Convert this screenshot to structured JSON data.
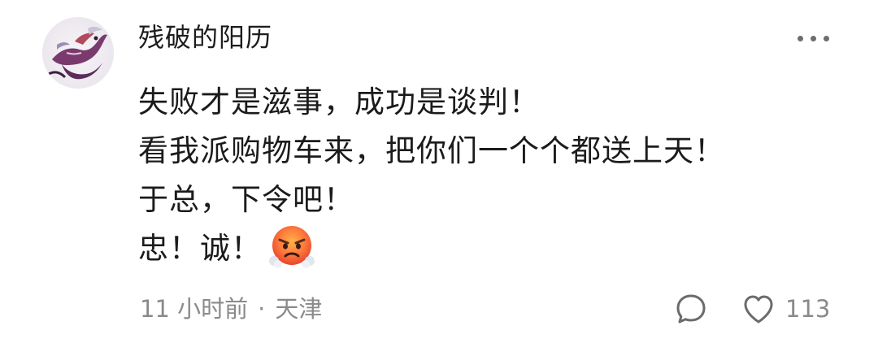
{
  "comment": {
    "username": "残破的阳历",
    "lines": [
      "失败才是滋事，成功是谈判！",
      "看我派购物车来，把你们一个个都送上天！",
      "于总，下令吧！",
      "忠！诚！"
    ],
    "emoji_icon": "angry-face-emoji",
    "time_ago": "11 小时前",
    "separator": "·",
    "location": "天津",
    "like_count": "113",
    "icons": {
      "more": "more-dots-icon",
      "reply": "comment-bubble-icon",
      "like": "heart-icon"
    }
  }
}
